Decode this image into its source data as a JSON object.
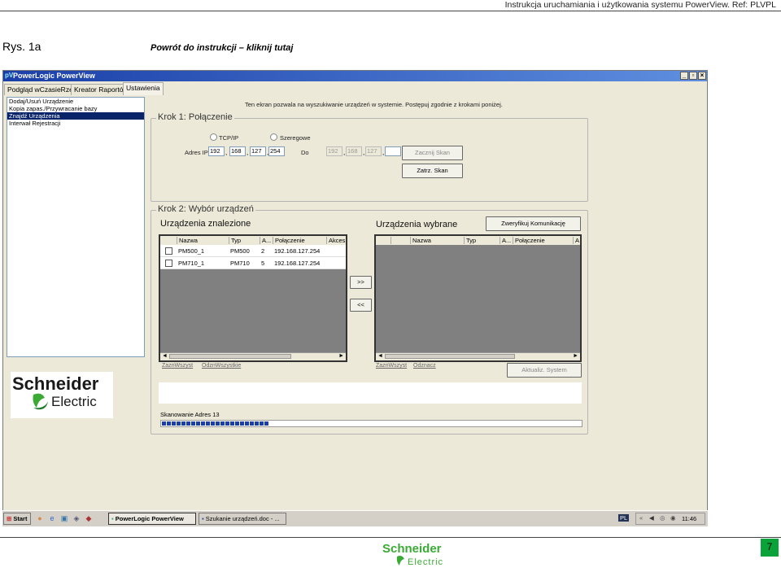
{
  "doc_header": "Instrukcja uruchamiania i użytkowania systemu PowerView.     Ref: PLVPL",
  "figure_label": "Rys. 1a",
  "back_link": "Powrót do instrukcji – kliknij tutaj",
  "window": {
    "title": "PowerLogic PowerView",
    "title_icon": "pv-logo-icon",
    "caption_buttons": [
      "_",
      "▫",
      "×"
    ]
  },
  "tabs": [
    "Podgląd wCzasieRzecz",
    "Kreator Raportów",
    "Ustawienia"
  ],
  "active_tab": "Ustawienia",
  "left_menu": [
    "Dodaj/Usuń Urządzenie",
    "Kopia zapas./Przywracanie bazy",
    "Znajdź Urządzenia",
    "Interwał Rejestracji"
  ],
  "left_menu_selected": "Znajdź Urządzenia",
  "intro_text": "Ten ekran pozwala na wyszukiwanie urządzeń w systemie. Postępuj zgodnie z krokami poniżej.",
  "step1": {
    "title": "Krok 1: Połączenie",
    "radio_tcp": "TCP/IP",
    "radio_serial": "Szeregowe",
    "ip_label": "Adres IP",
    "ip": [
      "192",
      "168",
      "127",
      "254"
    ],
    "to_label": "Do",
    "ip_to": [
      "192",
      "168",
      "127",
      ""
    ],
    "start_scan": "Zacznij Skan",
    "stop_scan": "Zatrz. Skan"
  },
  "step2": {
    "title": "Krok 2: Wybór urządzeń",
    "found_heading": "Urządzenia znalezione",
    "selected_heading": "Urządzenia wybrane",
    "verify_button": "Zweryfikuj Komunikację",
    "found_columns": [
      "Nazwa",
      "Typ",
      "A...",
      "Połączenie",
      "Akces"
    ],
    "found_rows": [
      {
        "name": "PM500_1",
        "type": "PM500",
        "addr": "2",
        "conn": "192.168.127.254"
      },
      {
        "name": "PM710_1",
        "type": "PM710",
        "addr": "5",
        "conn": "192.168.127.254"
      }
    ],
    "selected_columns": [
      "Nazwa",
      "Typ",
      "A...",
      "Połączenie",
      "A"
    ],
    "add_button": ">>",
    "remove_button": "<<",
    "found_select_all": "ZaznWszyst",
    "found_deselect_all": "OdznWszystkie",
    "sel_select_all": "ZaznWszyst",
    "sel_deselect": "Odznacz",
    "update_button": "Aktualiz. System",
    "scan_status": "Skanowanie Adres 13",
    "progress": 0.26
  },
  "logo_text": {
    "line1": "Schneider",
    "line2": "Electric"
  },
  "taskbar": {
    "start": "Start",
    "items": [
      "PowerLogic PowerView",
      "Szukanie urządzeń.doc - ..."
    ],
    "lang": "PL",
    "time": "11:46"
  },
  "page_number": "7",
  "colors": {
    "title_blue": "#1a3fa8",
    "selection": "#0a246a",
    "green": "#0aa33a"
  }
}
